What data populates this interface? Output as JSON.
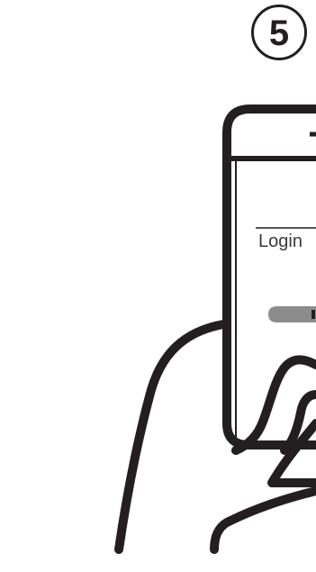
{
  "step": {
    "number": "5"
  },
  "phone_screen": {
    "login_label": "Login",
    "button_label": ""
  },
  "colors": {
    "outline": "#231f20",
    "text": "#3a3a3a",
    "button_fill": "#8c8c8c",
    "background": "#ffffff"
  },
  "icons": [
    "phone-in-hand-illustration",
    "step-number-badge"
  ]
}
